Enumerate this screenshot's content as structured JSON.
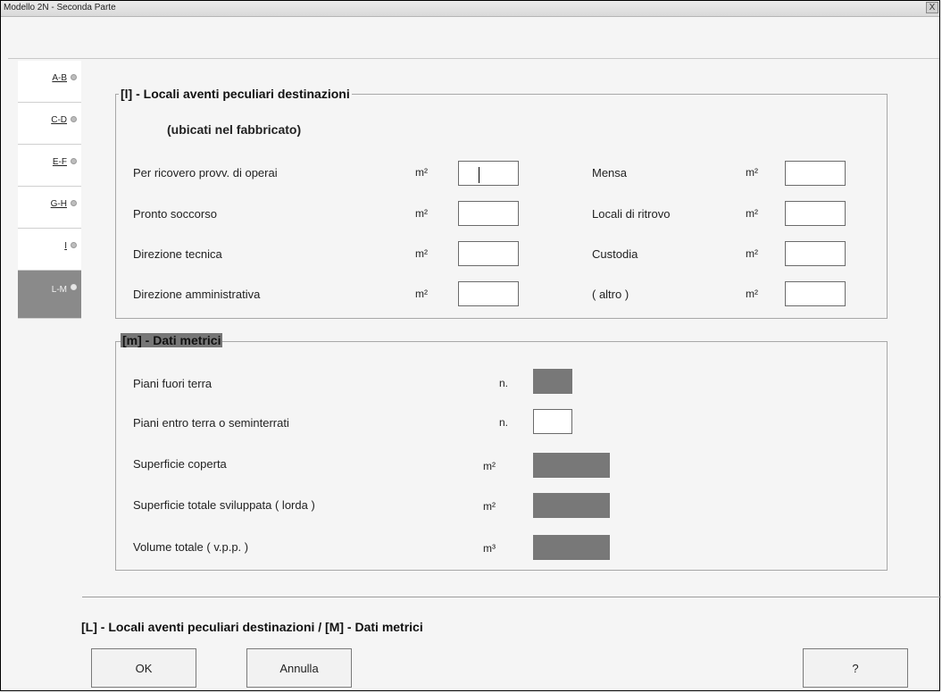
{
  "window": {
    "title": "Modello 2N - Seconda Parte",
    "close_label": "X"
  },
  "tabs": [
    {
      "label": "A-B",
      "active": false
    },
    {
      "label": "C-D",
      "active": false
    },
    {
      "label": "E-F",
      "active": false
    },
    {
      "label": "G-H",
      "active": false
    },
    {
      "label": "I",
      "active": false
    },
    {
      "label": "L-M",
      "active": true
    }
  ],
  "section_l": {
    "title": "[l] - Locali aventi  peculiari destinazioni",
    "subtitle": "(ubicati nel fabbricato)",
    "unit": "m²",
    "left_fields": [
      {
        "label": "Per ricovero provv. di operai",
        "value": ""
      },
      {
        "label": "Pronto soccorso",
        "value": ""
      },
      {
        "label": "Direzione tecnica",
        "value": ""
      },
      {
        "label": "Direzione amministrativa",
        "value": ""
      }
    ],
    "right_fields": [
      {
        "label": "Mensa",
        "value": ""
      },
      {
        "label": "Locali di ritrovo",
        "value": ""
      },
      {
        "label": "Custodia",
        "value": ""
      },
      {
        "label": "( altro )",
        "value": ""
      }
    ]
  },
  "section_m": {
    "title": "[m] - Dati metrici",
    "fields": [
      {
        "label": "Piani fuori terra",
        "unit": "n.",
        "value": "",
        "disabled": true
      },
      {
        "label": "Piani entro terra o seminterrati",
        "unit": "n.",
        "value": "",
        "disabled": false
      },
      {
        "label": "Superficie coperta",
        "unit": "m²",
        "value": "",
        "disabled": true
      },
      {
        "label": "Superficie totale sviluppata ( lorda )",
        "unit": "m²",
        "value": "",
        "disabled": true
      },
      {
        "label": "Volume totale ( v.p.p. )",
        "unit": "m³",
        "value": "",
        "disabled": true
      }
    ]
  },
  "status_text": "[L] - Locali aventi peculiari destinazioni / [M] - Dati metrici",
  "buttons": {
    "ok": "OK",
    "cancel": "Annulla",
    "help": "?"
  }
}
